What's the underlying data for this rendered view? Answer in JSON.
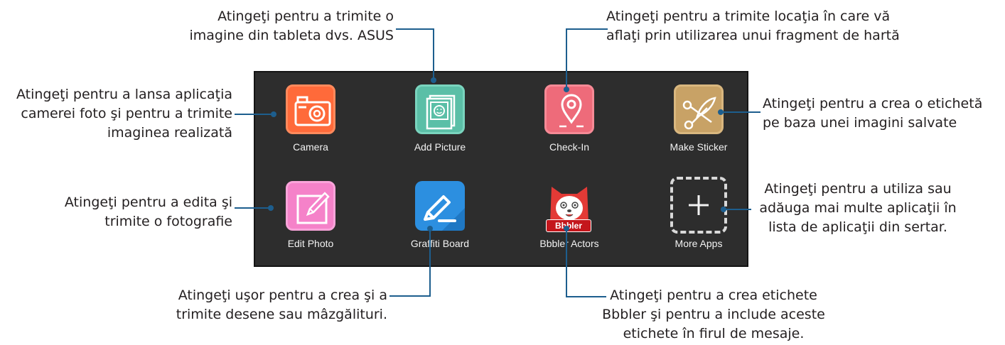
{
  "colors": {
    "panel_bg": "#2d2d2d",
    "leader_line": "#1d5e8e",
    "camera": "#ff6a3a",
    "add_picture": "#5bbfa7",
    "check_in": "#ee6b7a",
    "make_sticker": "#c8a266",
    "edit_photo": "#f582c9",
    "graffiti_board": "#2c8fe0",
    "bbbler_actors": "#e33a36",
    "more_apps": "#2d2d2d"
  },
  "apps": [
    {
      "label": "Camera",
      "icon": "camera-icon"
    },
    {
      "label": "Add Picture",
      "icon": "picture-icon"
    },
    {
      "label": "Check-In",
      "icon": "location-pin-icon"
    },
    {
      "label": "Make Sticker",
      "icon": "scissors-icon"
    },
    {
      "label": "Edit Photo",
      "icon": "pencil-icon"
    },
    {
      "label": "Graffiti Board",
      "icon": "marker-icon"
    },
    {
      "label": "Bbbler Actors",
      "icon": "bbbler-character-icon"
    },
    {
      "label": "More Apps",
      "icon": "plus-icon"
    }
  ],
  "bbbler_badge": "Bbbler",
  "callouts": {
    "add_picture": [
      "Atingeţi pentru a trimite o",
      "imagine din tableta dvs. ASUS"
    ],
    "check_in": [
      "Atingeţi pentru a trimite locaţia în care vă",
      "aflaţi prin utilizarea unui fragment de hartă"
    ],
    "camera": [
      "Atingeţi pentru a lansa aplicaţia",
      "camerei foto şi pentru a trimite",
      "imaginea realizată"
    ],
    "make_sticker": [
      "Atingeţi pentru a crea o etichetă",
      "pe baza unei imagini salvate"
    ],
    "edit_photo": [
      "Atingeţi pentru a edita şi",
      "trimite o fotografie"
    ],
    "more_apps": [
      "Atingeţi pentru a utiliza sau",
      "adăuga mai multe aplicaţii în",
      "lista de aplicaţii din sertar."
    ],
    "graffiti_board": [
      "Atingeţi uşor pentru a crea şi a",
      "trimite desene sau mâzgălituri."
    ],
    "bbbler_actors": [
      "Atingeţi pentru a crea etichete",
      "Bbbler şi pentru a include aceste",
      "etichete în firul de mesaje."
    ]
  }
}
